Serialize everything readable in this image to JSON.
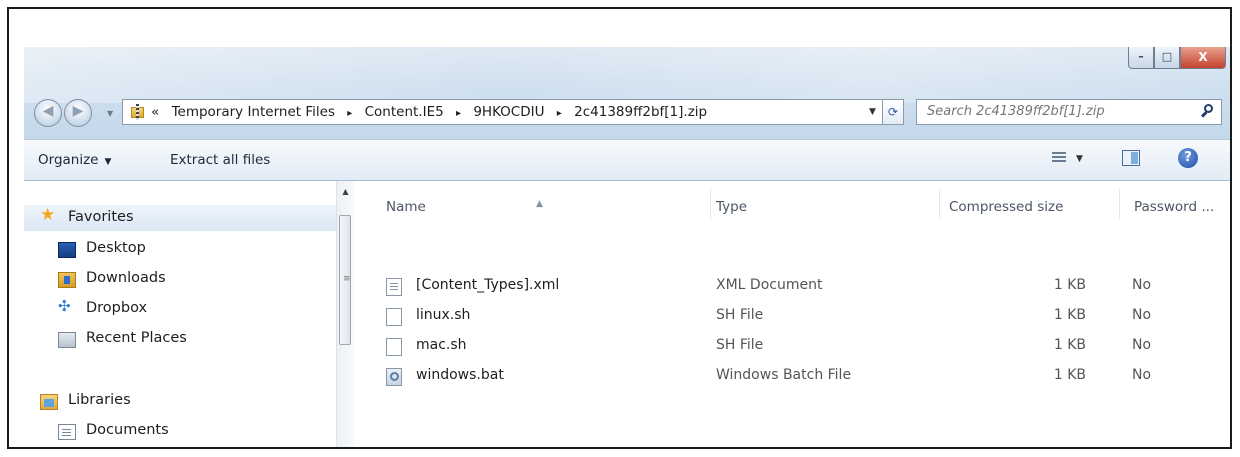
{
  "window": {
    "controls": {
      "minimize_glyph": "–",
      "maximize_glyph": "□",
      "close_glyph": "X"
    }
  },
  "address": {
    "breadcrumb_prefix": "«",
    "crumbs": [
      "Temporary Internet Files",
      "Content.IE5",
      "9HKOCDIU",
      "2c41389ff2bf[1].zip"
    ],
    "separator": "▸"
  },
  "search": {
    "placeholder": "Search 2c41389ff2bf[1].zip"
  },
  "toolbar": {
    "organize_label": "Organize",
    "extract_label": "Extract all files"
  },
  "nav": {
    "favorites_label": "Favorites",
    "favorites": [
      "Desktop",
      "Downloads",
      "Dropbox",
      "Recent Places"
    ],
    "libraries_label": "Libraries",
    "libraries": [
      "Documents"
    ]
  },
  "columns": {
    "name": "Name",
    "type": "Type",
    "size": "Compressed size",
    "password": "Password ..."
  },
  "files": [
    {
      "name": "[Content_Types].xml",
      "type": "XML Document",
      "size": "1 KB",
      "password": "No",
      "icon": "xml-file-icon"
    },
    {
      "name": "linux.sh",
      "type": "SH File",
      "size": "1 KB",
      "password": "No",
      "icon": "file-icon"
    },
    {
      "name": "mac.sh",
      "type": "SH File",
      "size": "1 KB",
      "password": "No",
      "icon": "file-icon"
    },
    {
      "name": "windows.bat",
      "type": "Windows Batch File",
      "size": "1 KB",
      "password": "No",
      "icon": "batch-file-icon"
    }
  ],
  "colors": {
    "chrome": "#cfe0ef",
    "close_button": "#c4432c",
    "favorites_star": "#f1a81c"
  }
}
